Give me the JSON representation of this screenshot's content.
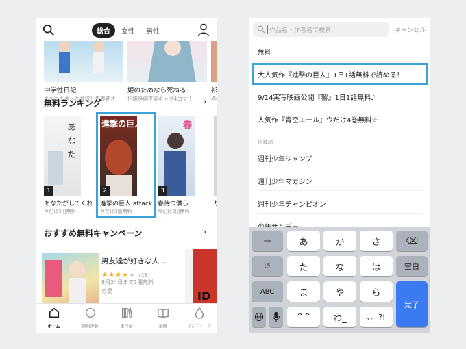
{
  "left": {
    "header": {
      "tabs": [
        {
          "label": "総合",
          "active": true
        },
        {
          "label": "女性",
          "active": false
        },
        {
          "label": "男性",
          "active": false
        }
      ]
    },
    "featured": [
      {
        "title": "中学性日記",
        "sub": "あなたもきっと共感！思春期オ"
      },
      {
        "title": "姫のためなら死ねる",
        "sub": "抱腹絶倒平安ギャグ4コマ!!"
      },
      {
        "title": "衫",
        "sub": "20"
      }
    ],
    "ranking": {
      "heading": "無料ランキング",
      "items": [
        {
          "rank": "1",
          "title": "あなたがしてくれ",
          "sub": "今だけ3冊無料"
        },
        {
          "rank": "2",
          "title": "進撃の巨人 attack",
          "sub": "今だけ3冊無料",
          "cover_text": "進撃の巨人"
        },
        {
          "rank": "3",
          "title": "春待つ僕ら",
          "sub": "今だけ3冊無料",
          "cover_text": "春"
        },
        {
          "rank": "",
          "title": "り",
          "sub": ""
        }
      ]
    },
    "campaign": {
      "heading": "おすすめ無料キャンペーン",
      "title": "男友達が好きな人…",
      "rating_count": "(18)",
      "rating": 4,
      "date": "8月24日まで1冊無料",
      "genre": "恋愛"
    },
    "tabbar": [
      {
        "label": "ホーム",
        "icon": "home-icon",
        "active": true
      },
      {
        "label": "無料連載",
        "icon": "free-serial-icon",
        "active": false
      },
      {
        "label": "単行本",
        "icon": "books-icon",
        "active": false
      },
      {
        "label": "本棚",
        "icon": "bookshelf-icon",
        "active": false
      },
      {
        "label": "インディーズ",
        "icon": "indies-icon",
        "active": false
      }
    ]
  },
  "right": {
    "search": {
      "placeholder": "作品名・作者名で検索",
      "cancel": "キャンセル"
    },
    "sections": [
      {
        "label": "無料"
      },
      {
        "label": "掲載誌"
      }
    ],
    "free_items": [
      "大人気作『進撃の巨人』1日1話無料で読める！",
      "9/14実写映画公開『響』1日1話無料♪",
      "人気作『青空エール』今だけ4巻無料☆"
    ],
    "magazines": [
      "週刊少年ジャンプ",
      "週刊少年マガジン",
      "週刊少年チャンピオン",
      "少年サンデー"
    ],
    "keyboard": {
      "row1": [
        "→",
        "あ",
        "か",
        "さ",
        "⌫"
      ],
      "row2": [
        "↺",
        "た",
        "な",
        "は",
        "空白"
      ],
      "row3": [
        "ABC",
        "ま",
        "や",
        "ら"
      ],
      "row4": [
        "🌐",
        "🎤",
        "^^",
        "わ_",
        "、。?!"
      ],
      "done": "完了"
    }
  }
}
